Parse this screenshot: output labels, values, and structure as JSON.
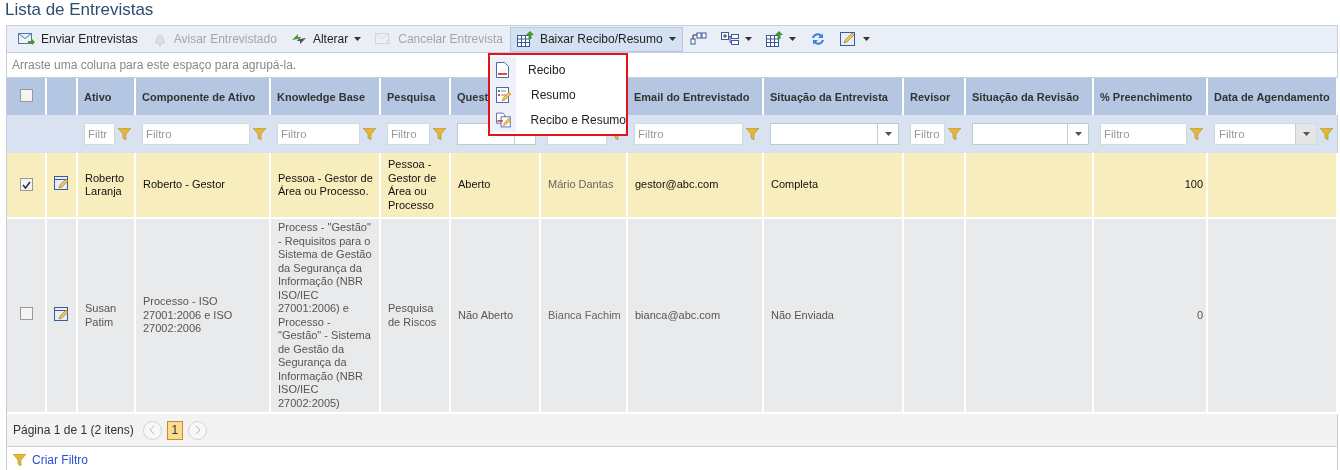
{
  "title": "Lista de Entrevistas",
  "toolbar": [
    {
      "label": "Enviar Entrevistas",
      "disabled": false,
      "dropdown": false,
      "pressed": false
    },
    {
      "label": "Avisar Entrevistado",
      "disabled": true,
      "dropdown": false,
      "pressed": false
    },
    {
      "label": "Alterar",
      "disabled": false,
      "dropdown": true,
      "pressed": false
    },
    {
      "label": "Cancelar Entrevista",
      "disabled": true,
      "dropdown": false,
      "pressed": false
    },
    {
      "label": "Baixar Recibo/Resumo",
      "disabled": false,
      "dropdown": true,
      "pressed": true
    },
    {
      "disabled": false,
      "dropdown": false,
      "pressed": false
    },
    {
      "disabled": false,
      "dropdown": true,
      "pressed": false
    },
    {
      "disabled": false,
      "dropdown": true,
      "pressed": false
    },
    {
      "disabled": false,
      "dropdown": false,
      "pressed": false
    },
    {
      "disabled": false,
      "dropdown": true,
      "pressed": false
    }
  ],
  "download_menu": {
    "items": [
      "Recibo",
      "Resumo",
      "Recibo e Resumo"
    ]
  },
  "group_hint": "Arraste uma coluna para este espaço para agrupá-la.",
  "table": {
    "all_selected": false,
    "columns": [
      {
        "label": "Ativo",
        "filter": {
          "kind": "text",
          "placeholder": "Filtr"
        }
      },
      {
        "label": "Componente de Ativo",
        "filter": {
          "kind": "text",
          "placeholder": "Filtro"
        }
      },
      {
        "label": "Knowledge Base",
        "filter": {
          "kind": "text",
          "placeholder": "Filtro"
        }
      },
      {
        "label": "Pesquisa",
        "filter": {
          "kind": "text",
          "placeholder": "Filtro"
        }
      },
      {
        "label": "Quest",
        "filter": {
          "kind": "select"
        }
      },
      {
        "filter": {
          "kind": "text"
        }
      },
      {
        "label": "Email do Entrevistado",
        "filter": {
          "kind": "text",
          "placeholder": "Filtro"
        }
      },
      {
        "label": "Situação da Entrevista",
        "filter": {
          "kind": "select"
        }
      },
      {
        "label": "Revisor",
        "filter": {
          "kind": "text",
          "placeholder": "Filtro"
        }
      },
      {
        "label": "Situação da Revisão",
        "filter": {
          "kind": "select"
        }
      },
      {
        "label": "% Preenchimento",
        "numeric": true,
        "filter": {
          "kind": "text",
          "placeholder": "Filtro"
        }
      },
      {
        "label": "Data de Agendamento",
        "filter": {
          "kind": "date",
          "placeholder": "Filtro"
        }
      }
    ],
    "rows": [
      {
        "selected": true,
        "cells": [
          "Roberto Laranja",
          "Roberto - Gestor",
          "Pessoa - Gestor de Área ou Processo.",
          "Pessoa - Gestor de Área ou Processo",
          "Aberto",
          "Mário Dantas",
          "gestor@abc.com",
          "Completa",
          "",
          "",
          "100",
          ""
        ]
      },
      {
        "selected": false,
        "cells": [
          "Susan Patim",
          "Processo - ISO 27001:2006 e ISO 27002:2006",
          "Process - \"Gestão\" - Requisitos para o Sistema de Gestão da Segurança da Informação (NBR ISO/IEC 27001:2006) e Processo - \"Gestão\" - Sistema de Gestão da Segurança da Informação (NBR ISO/IEC 27002:2005)",
          "Pesquisa de Riscos",
          "Não Aberto",
          "Bianca Fachim",
          "bianca@abc.com",
          "Não Enviada",
          "",
          "",
          "0",
          ""
        ]
      }
    ]
  },
  "pager": {
    "summary": "Página 1 de 1 (2 itens)",
    "pages": [
      {
        "label": "1",
        "selected": true
      }
    ]
  },
  "footer_link": "Criar Filtro"
}
